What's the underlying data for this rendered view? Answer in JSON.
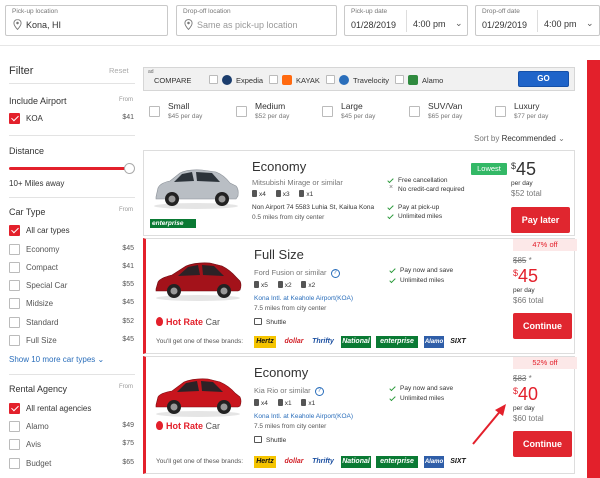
{
  "search": {
    "pickup_location": {
      "label": "Pick-up location",
      "value": "Kona, HI"
    },
    "dropoff_location": {
      "label": "Drop-off location",
      "placeholder": "Same as pick-up location"
    },
    "pickup_date": {
      "label": "Pick-up date",
      "date": "01/28/2019",
      "time": "4:00 pm"
    },
    "dropoff_date": {
      "label": "Drop-off date",
      "date": "01/29/2019",
      "time": "4:00 pm"
    }
  },
  "filter": {
    "title": "Filter",
    "reset": "Reset",
    "include_airport": {
      "heading": "Include Airport",
      "from": "From",
      "items": [
        {
          "label": "KOA",
          "price": "$41",
          "checked": true
        }
      ]
    },
    "distance": {
      "heading": "Distance",
      "value": "10+ Miles away"
    },
    "car_type": {
      "heading": "Car Type",
      "from": "From",
      "items": [
        {
          "label": "All car types",
          "price": "",
          "checked": true
        },
        {
          "label": "Economy",
          "price": "$45",
          "checked": false
        },
        {
          "label": "Compact",
          "price": "$41",
          "checked": false
        },
        {
          "label": "Special Car",
          "price": "$55",
          "checked": false
        },
        {
          "label": "Midsize",
          "price": "$45",
          "checked": false
        },
        {
          "label": "Standard",
          "price": "$52",
          "checked": false
        },
        {
          "label": "Full Size",
          "price": "$45",
          "checked": false
        }
      ],
      "more": "Show 10 more car types"
    },
    "rental_agency": {
      "heading": "Rental Agency",
      "from": "From",
      "items": [
        {
          "label": "All rental agencies",
          "price": "",
          "checked": true
        },
        {
          "label": "Alamo",
          "price": "$49",
          "checked": false
        },
        {
          "label": "Avis",
          "price": "$75",
          "checked": false
        },
        {
          "label": "Budget",
          "price": "$65",
          "checked": false
        }
      ]
    }
  },
  "compare": {
    "ad": "ad",
    "label": "COMPARE",
    "sites": [
      {
        "name": "Expedia",
        "logo_color": "#1b3d6d"
      },
      {
        "name": "KAYAK",
        "logo_color": "#ff690f"
      },
      {
        "name": "Travelocity",
        "logo_color": "#2a6ebb"
      },
      {
        "name": "Alamo",
        "logo_color": "#2f8a3f"
      }
    ],
    "go": "GO"
  },
  "sizes": [
    {
      "name": "Small",
      "price": "$45 per day"
    },
    {
      "name": "Medium",
      "price": "$52 per day"
    },
    {
      "name": "Large",
      "price": "$45 per day"
    },
    {
      "name": "SUV/Van",
      "price": "$65 per day"
    },
    {
      "name": "Luxury",
      "price": "$77 per day"
    }
  ],
  "sort": {
    "label": "Sort by",
    "value": "Recommended"
  },
  "results": [
    {
      "title": "Economy",
      "subtitle": "Mitsubishi Mirage or similar",
      "features": [
        "x4",
        "x3",
        "x1"
      ],
      "location": "Non Airport 74 5583 Luhia St, Kailua Kona",
      "distance": "0.5 miles from city center",
      "checks": [
        "Free cancellation",
        "No credit-card required",
        "Pay at pick-up",
        "Unlimited miles"
      ],
      "badge": "Lowest",
      "price": "45",
      "per_day": "per day",
      "total": "$52 total",
      "button": "Pay later",
      "vendor": "enterprise",
      "car_color": "#b9bec4"
    },
    {
      "title": "Full Size",
      "subtitle": "Ford Fusion or similar",
      "features": [
        "x5",
        "x2",
        "x2"
      ],
      "location": "Kona Intl. at Keahole Airport(KOA)",
      "distance": "7.5 miles from city center",
      "shuttle": "Shuttle",
      "checks": [
        "Pay now and save",
        "Unlimited miles"
      ],
      "off": "47% off",
      "was": "$85",
      "price": "45",
      "per_day": "per day",
      "total": "$66 total",
      "button": "Continue",
      "hot_rate": "Hot Rate",
      "hot_rate_suffix": "Car",
      "brands_text": "You'll get one of these brands:",
      "car_color": "#a3121a"
    },
    {
      "title": "Economy",
      "subtitle": "Kia Rio or similar",
      "features": [
        "x4",
        "x1",
        "x1"
      ],
      "location": "Kona Intl. at Keahole Airport(KOA)",
      "distance": "7.5 miles from city center",
      "shuttle": "Shuttle",
      "checks": [
        "Pay now and save",
        "Unlimited miles"
      ],
      "off": "52% off",
      "was": "$83",
      "price": "40",
      "per_day": "per day",
      "total": "$60 total",
      "button": "Continue",
      "hot_rate": "Hot Rate",
      "hot_rate_suffix": "Car",
      "brands_text": "You'll get one of these brands:",
      "car_color": "#c8151d"
    }
  ],
  "brands": [
    {
      "name": "Hertz",
      "color": "#f5c400",
      "text": "#111"
    },
    {
      "name": "dollar",
      "color": "#ffffff",
      "text": "#d2232a"
    },
    {
      "name": "Thrifty",
      "color": "#ffffff",
      "text": "#1b4fa0"
    },
    {
      "name": "National",
      "color": "#0a7a34",
      "text": "#ffffff"
    },
    {
      "name": "enterprise",
      "color": "#0a7a34",
      "text": "#ffffff"
    },
    {
      "name": "Alamo",
      "color": "#2f5ea8",
      "text": "#ffffff"
    },
    {
      "name": "SIXT",
      "color": "#ffffff",
      "text": "#111"
    }
  ],
  "colors": {
    "accent": "#e3202b",
    "go": "#1f64c9",
    "check": "#2e9b3d",
    "lowest": "#33b866",
    "link": "#2a6ebb"
  }
}
